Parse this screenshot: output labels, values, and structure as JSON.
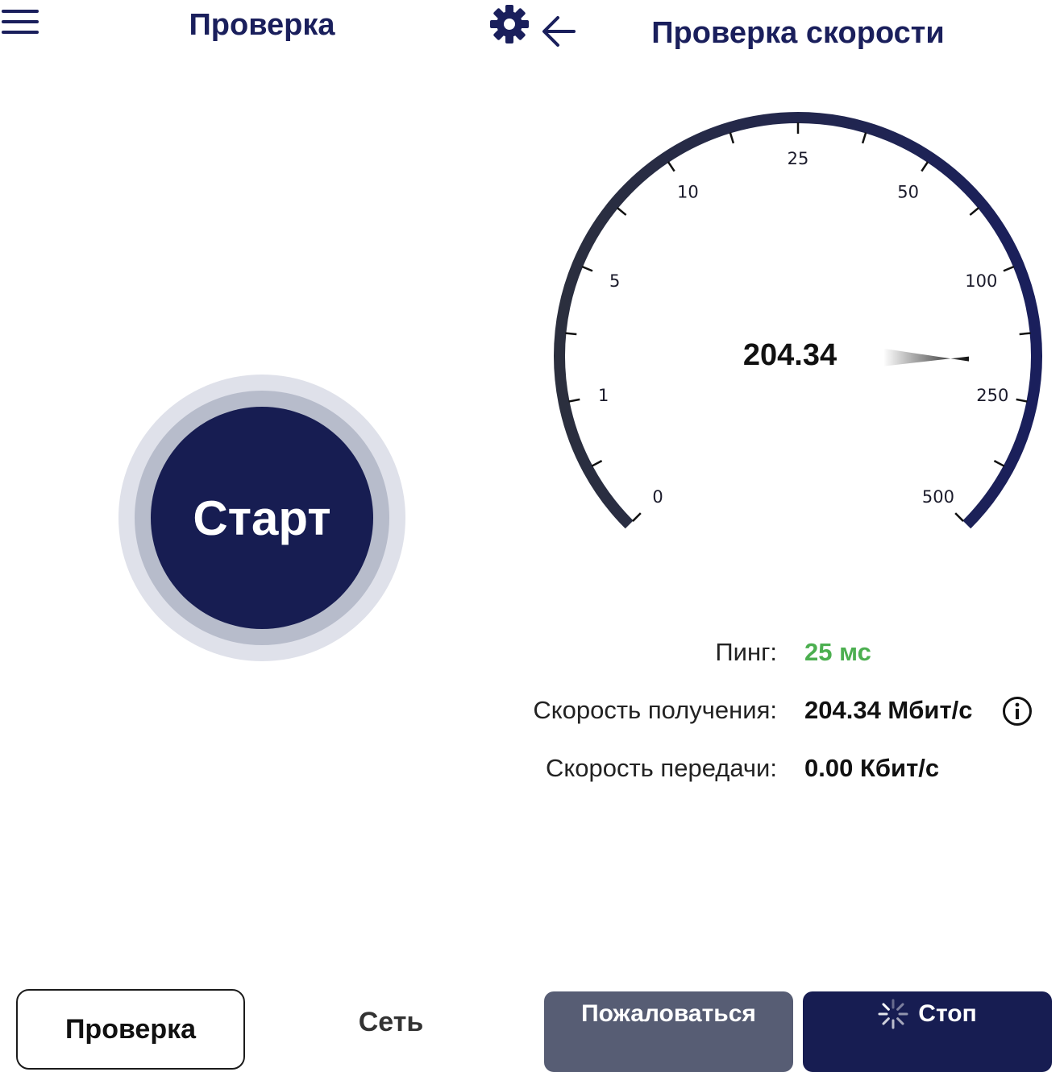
{
  "left_panel": {
    "title": "Проверка",
    "start_button_label": "Старт",
    "icons": {
      "menu": "hamburger-menu-icon",
      "settings": "gear-icon"
    }
  },
  "right_panel": {
    "title": "Проверка скорости",
    "icons": {
      "back": "arrow-left-icon",
      "info": "info-icon"
    },
    "gauge": {
      "value": "204.34",
      "reading": 204.34,
      "scale_labels": [
        "0",
        "1",
        "5",
        "10",
        "25",
        "50",
        "100",
        "250",
        "500"
      ],
      "arc_color_start": "#2b2f3e",
      "arc_color_end": "#1a1f5c"
    },
    "stats": {
      "ping_label": "Пинг:",
      "ping_value": "25 мс",
      "download_label": "Скорость получения:",
      "download_value": "204.34 Мбит/с",
      "upload_label": "Скорость передачи:",
      "upload_value": "0.00 Кбит/с"
    }
  },
  "bottom_nav": {
    "tab_check": "Проверка",
    "tab_network": "Сеть",
    "report_button": "Пожаловаться",
    "stop_button": "Стоп"
  },
  "colors": {
    "primary": "#171d52",
    "secondary_button": "#575d74",
    "ping_green": "#4caf50",
    "text_dark": "#111111"
  }
}
